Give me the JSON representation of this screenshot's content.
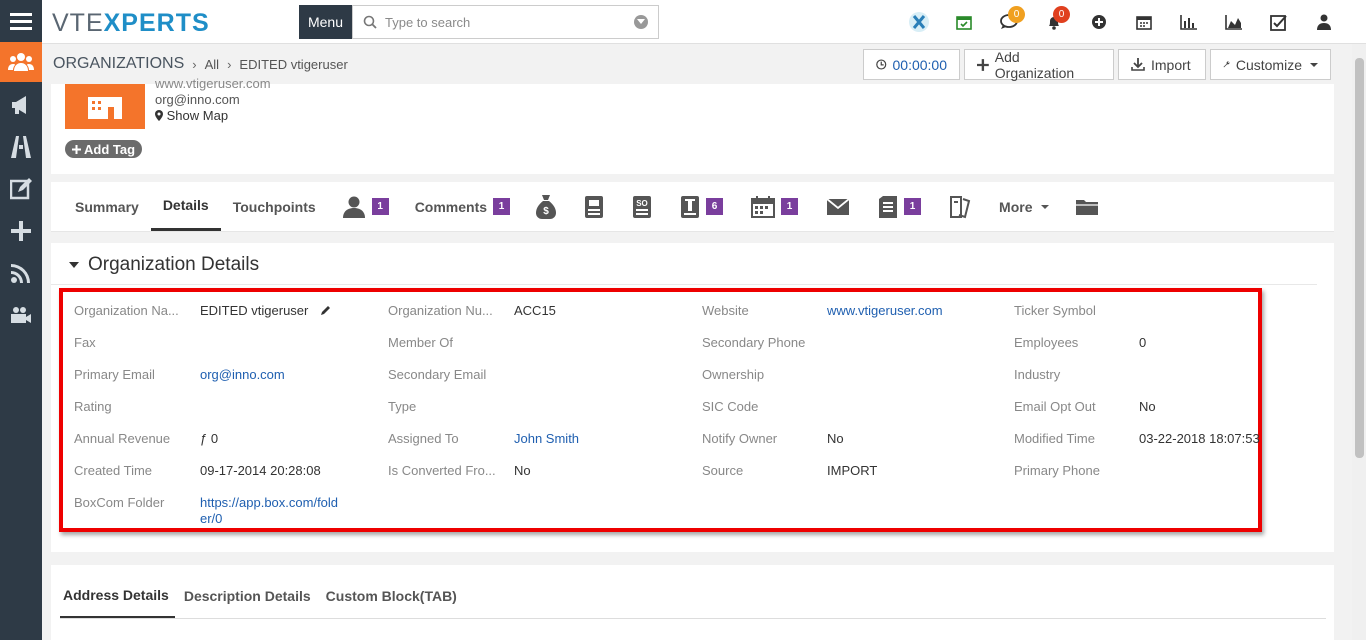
{
  "brand": {
    "logo_left": "VTE",
    "logo_right": "XPERTS",
    "accent": "#f4742b",
    "sidebar_bg": "#2e3a46",
    "link": "#1f5fb0",
    "highlight": "#e00000",
    "badge": "#7a3e9d"
  },
  "topbar": {
    "menu_label": "Menu",
    "search_placeholder": "Type to search",
    "icons": [
      "vtexperts-icon",
      "calendar-check-icon",
      "chat-icon",
      "bell-icon",
      "plus-circle-icon",
      "calendar-icon",
      "bar-chart-icon",
      "area-chart-icon",
      "tasks-check-icon",
      "user-icon"
    ],
    "chat_count": "0",
    "notification_count": "0"
  },
  "breadcrumb": {
    "module": "ORGANIZATIONS",
    "filter": "All",
    "record": "EDITED vtigeruser"
  },
  "header_buttons": {
    "timer": "00:00:00",
    "add": "Add Organization",
    "import": "Import",
    "customize": "Customize"
  },
  "record": {
    "website_partial": "www.vtigeruser.com",
    "email": "org@inno.com",
    "show_map": "Show Map",
    "add_tag": "Add Tag"
  },
  "tabs": {
    "summary": "Summary",
    "details": "Details",
    "touchpoints": "Touchpoints",
    "contacts_count": "1",
    "comments": "Comments",
    "comments_count": "1",
    "tickets_count": "6",
    "calendar_count": "1",
    "documents_count": "1",
    "more": "More"
  },
  "section": {
    "title": "Organization Details"
  },
  "fields": {
    "org_name_label": "Organization Na...",
    "org_name_value": "EDITED vtigeruser",
    "org_number_label": "Organization Nu...",
    "org_number_value": "ACC15",
    "website_label": "Website",
    "website_value": "www.vtigeruser.com",
    "ticker_label": "Ticker Symbol",
    "fax_label": "Fax",
    "member_of_label": "Member Of",
    "sec_phone_label": "Secondary Phone",
    "employees_label": "Employees",
    "employees_value": "0",
    "primary_email_label": "Primary Email",
    "primary_email_value": "org@inno.com",
    "sec_email_label": "Secondary Email",
    "ownership_label": "Ownership",
    "industry_label": "Industry",
    "rating_label": "Rating",
    "type_label": "Type",
    "sic_label": "SIC Code",
    "email_opt_label": "Email Opt Out",
    "email_opt_value": "No",
    "revenue_label": "Annual Revenue",
    "revenue_value": "ƒ 0",
    "assigned_label": "Assigned To",
    "assigned_value": "John Smith",
    "notify_label": "Notify Owner",
    "notify_value": "No",
    "modified_label": "Modified Time",
    "modified_value": "03-22-2018 18:07:53",
    "created_label": "Created Time",
    "created_value": "09-17-2014 20:28:08",
    "converted_label": "Is Converted Fro...",
    "converted_value": "No",
    "source_label": "Source",
    "source_value": "IMPORT",
    "primary_phone_label": "Primary Phone",
    "boxcom_label": "BoxCom Folder",
    "boxcom_value_1": "https://app.box.com/fold",
    "boxcom_value_2": "er/0"
  },
  "bottom_tabs": {
    "address": "Address Details",
    "description": "Description Details",
    "custom": "Custom Block(TAB)"
  }
}
